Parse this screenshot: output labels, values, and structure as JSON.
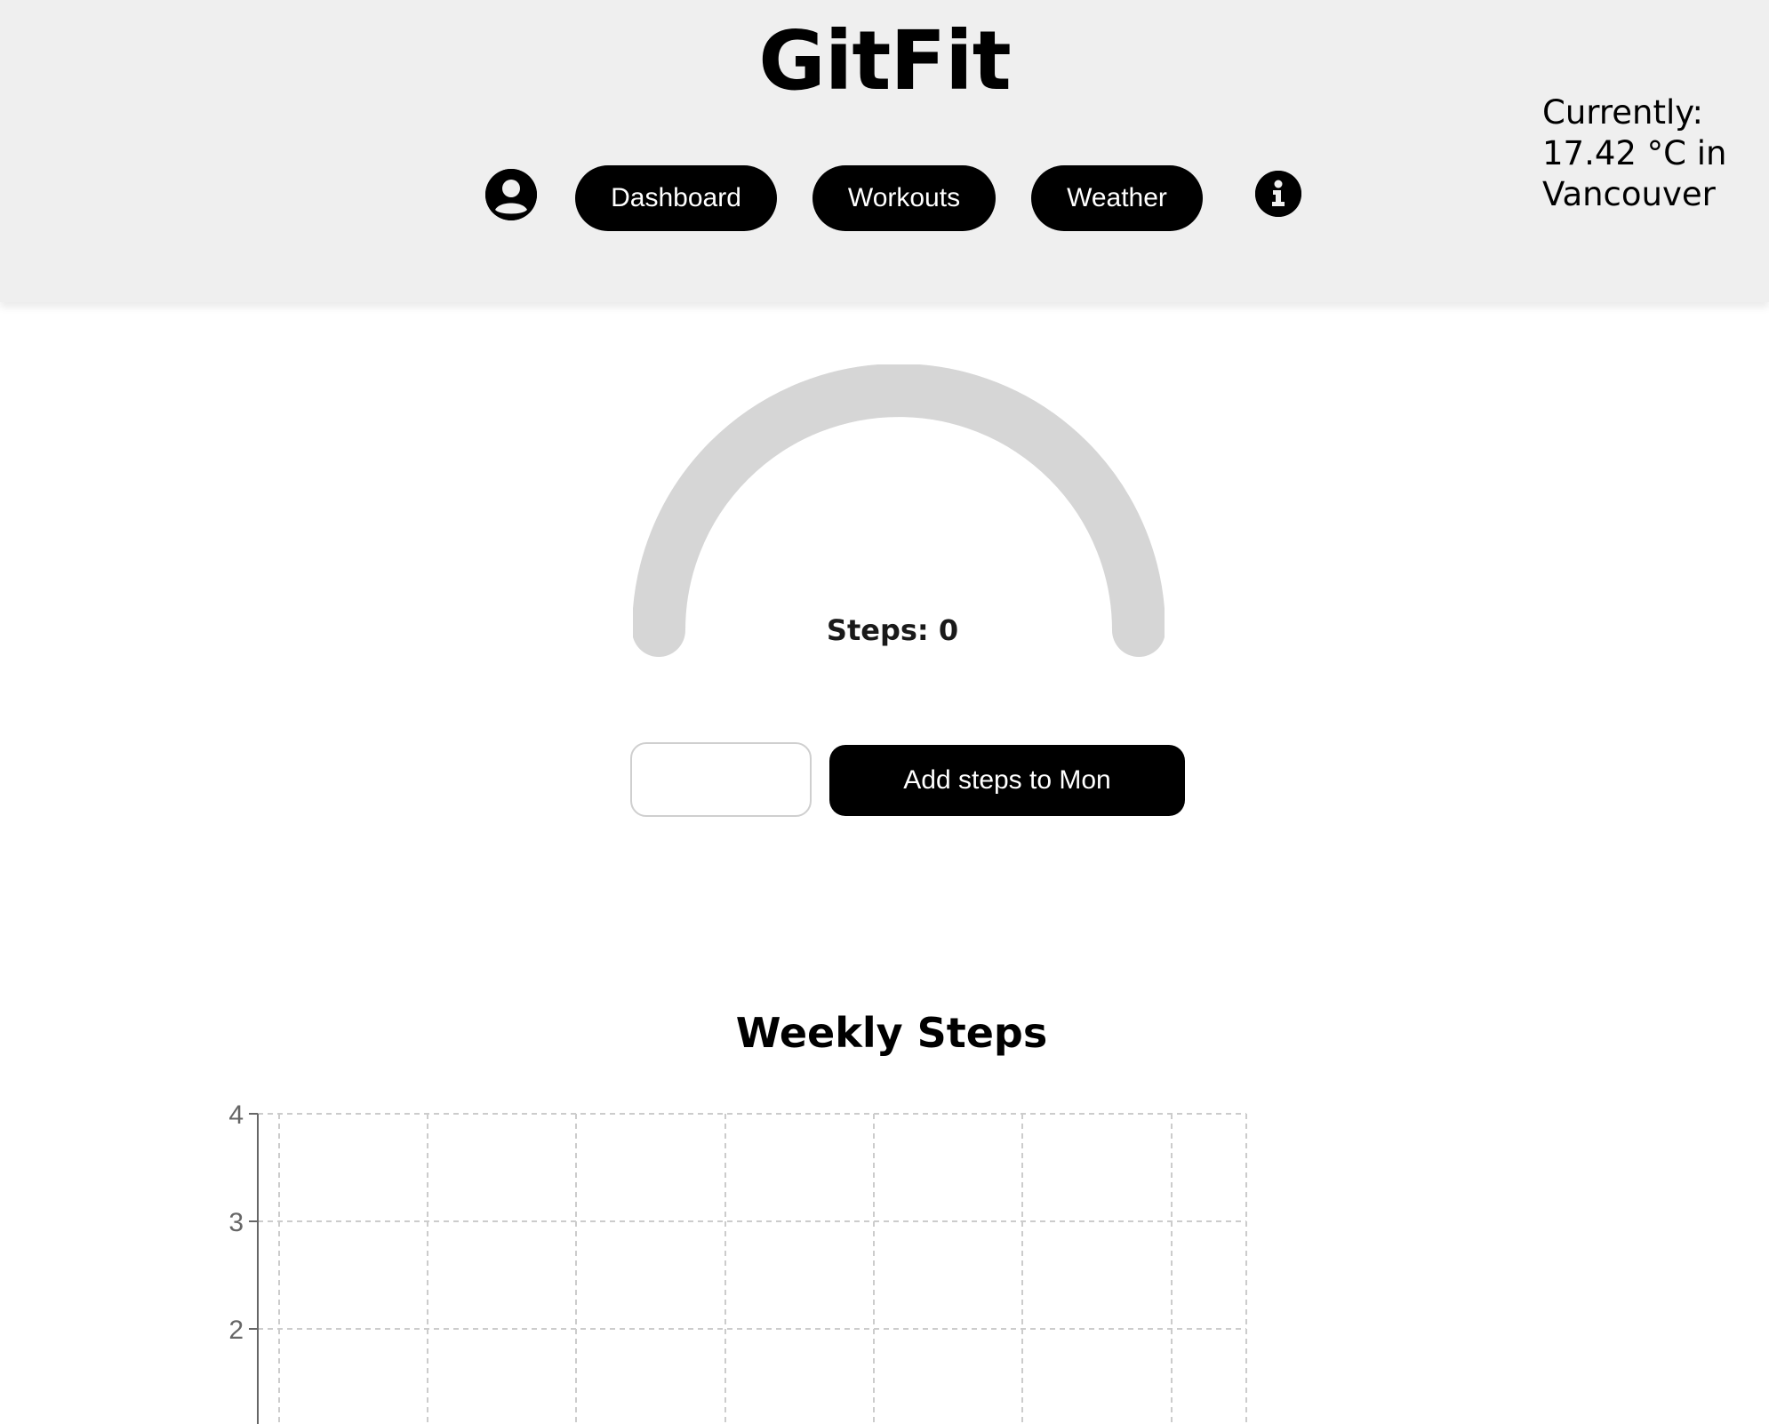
{
  "app": {
    "title": "GitFit"
  },
  "weather": {
    "readout": "Currently: 17.42 °C in Vancouver"
  },
  "nav": {
    "profile_icon": "user-circle-icon",
    "info_icon": "info-icon",
    "items": [
      {
        "label": "Dashboard"
      },
      {
        "label": "Workouts"
      },
      {
        "label": "Weather"
      }
    ]
  },
  "steps": {
    "label": "Steps: 0",
    "value": 0,
    "input_value": "",
    "add_button_label": "Add steps to Mon"
  },
  "colors": {
    "header_bg": "#efefef",
    "button_bg": "#000000",
    "gauge_track": "#d6d6d6"
  },
  "chart_data": {
    "type": "bar",
    "title": "Weekly Steps",
    "yticks": [
      4,
      3,
      2
    ],
    "grid": true,
    "values_visible": false
  }
}
